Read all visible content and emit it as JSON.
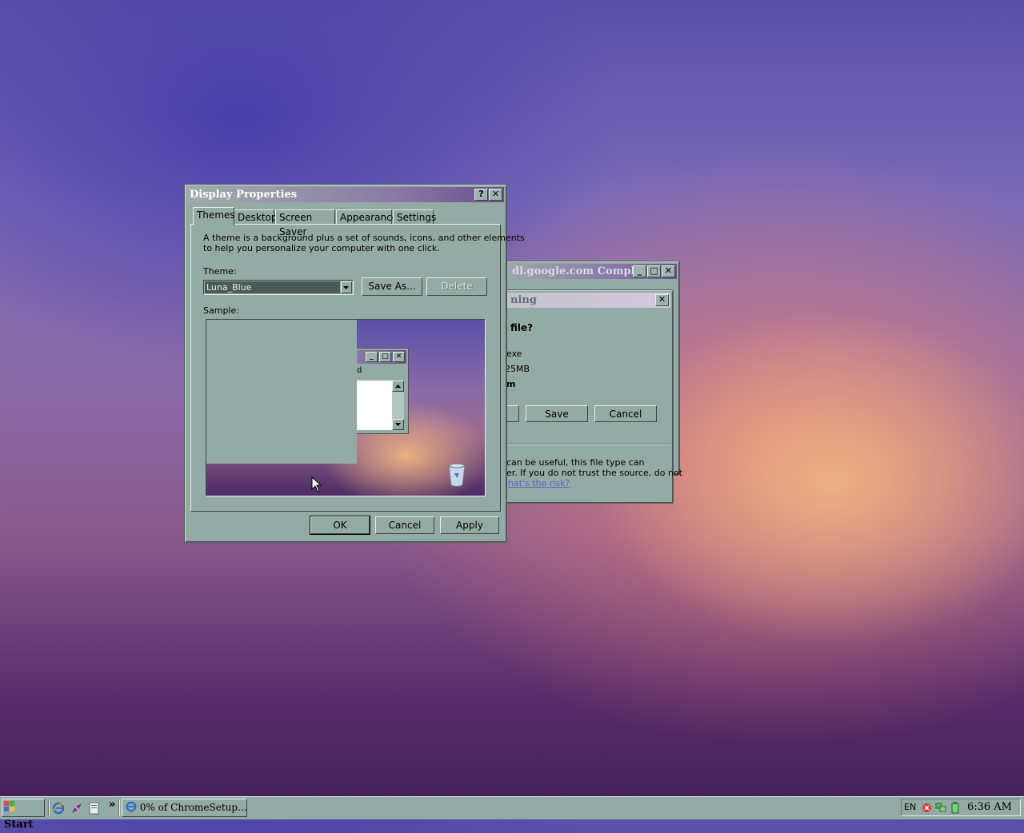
{
  "background_window": {
    "title": "dl.google.com Compl...",
    "inner_title": "ning",
    "question": "file?",
    "file_type_partial": "exe",
    "size_partial": "25MB",
    "from_partial": "m",
    "save_label": "Save",
    "cancel_label": "Cancel",
    "warning_line1": "can be useful, this file type can",
    "warning_line2": "er. If you do not trust the source, do not",
    "risk_link": "hat's the risk?"
  },
  "display_properties": {
    "title": "Display Properties",
    "help_glyph": "?",
    "close_glyph": "✕",
    "tabs": [
      {
        "label": "Themes"
      },
      {
        "label": "Desktop"
      },
      {
        "label": "Screen Saver"
      },
      {
        "label": "Appearance"
      },
      {
        "label": "Settings"
      }
    ],
    "description_line1": "A theme is a background plus a set of sounds, icons, and other elements",
    "description_line2": "to help you personalize your computer with one click.",
    "theme_label": "Theme:",
    "theme_value": "Luna_Blue",
    "save_as_label": "Save As...",
    "delete_label": "Delete",
    "sample_label": "Sample:",
    "sample_window_partial": "d",
    "ok_label": "OK",
    "cancel_label": "Cancel",
    "apply_label": "Apply"
  },
  "taskbar": {
    "start_label": "Start",
    "chevron": "»",
    "task_label": "0% of ChromeSetup....",
    "lang": "EN",
    "clock": "6:36 AM"
  },
  "colors": {
    "window_face": "#94aaa4",
    "title_gradient_start": "#a2acac",
    "title_gradient_end": "#6a4f8e",
    "link": "#5a62c8"
  }
}
